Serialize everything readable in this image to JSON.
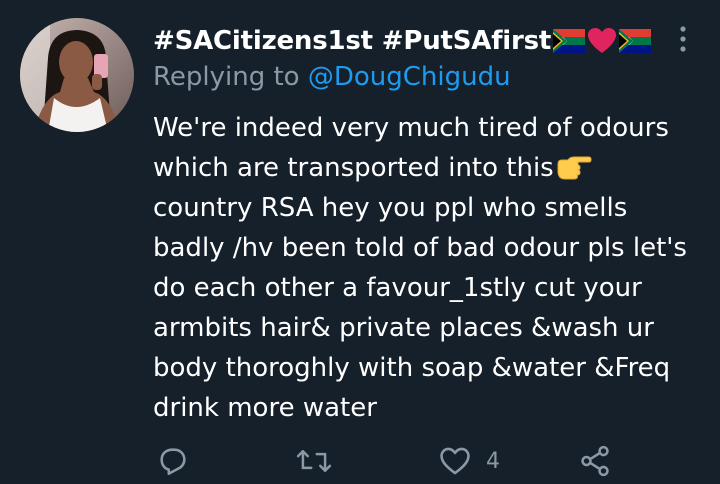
{
  "tweet": {
    "display_name": "#SACitizens1st #PutSAfirst",
    "reply_prefix": "Replying to",
    "reply_handle": "@DougChigudu",
    "body_lines": [
      "We're indeed very much tired of odours",
      "which are transported into this",
      "country RSA hey you ppl who smells",
      "badly /hv been told of bad odour pls let's",
      "do each other a favour_1stly cut your",
      "armbits hair& private places &wash ur",
      "body thoroghly with soap &water &Freq",
      "drink more water"
    ],
    "emojis": [
      "south-africa-flag",
      "red-heart",
      "south-africa-flag",
      "backhand-index-pointing-right"
    ]
  },
  "actions": {
    "reply_icon": "reply-icon",
    "retweet_icon": "retweet-icon",
    "like_icon": "heart-outline-icon",
    "like_count": "4",
    "share_icon": "share-icon"
  },
  "colors": {
    "background": "#15202b",
    "text": "#ffffff",
    "secondary": "#8b98a5",
    "link": "#1d9bf0"
  }
}
